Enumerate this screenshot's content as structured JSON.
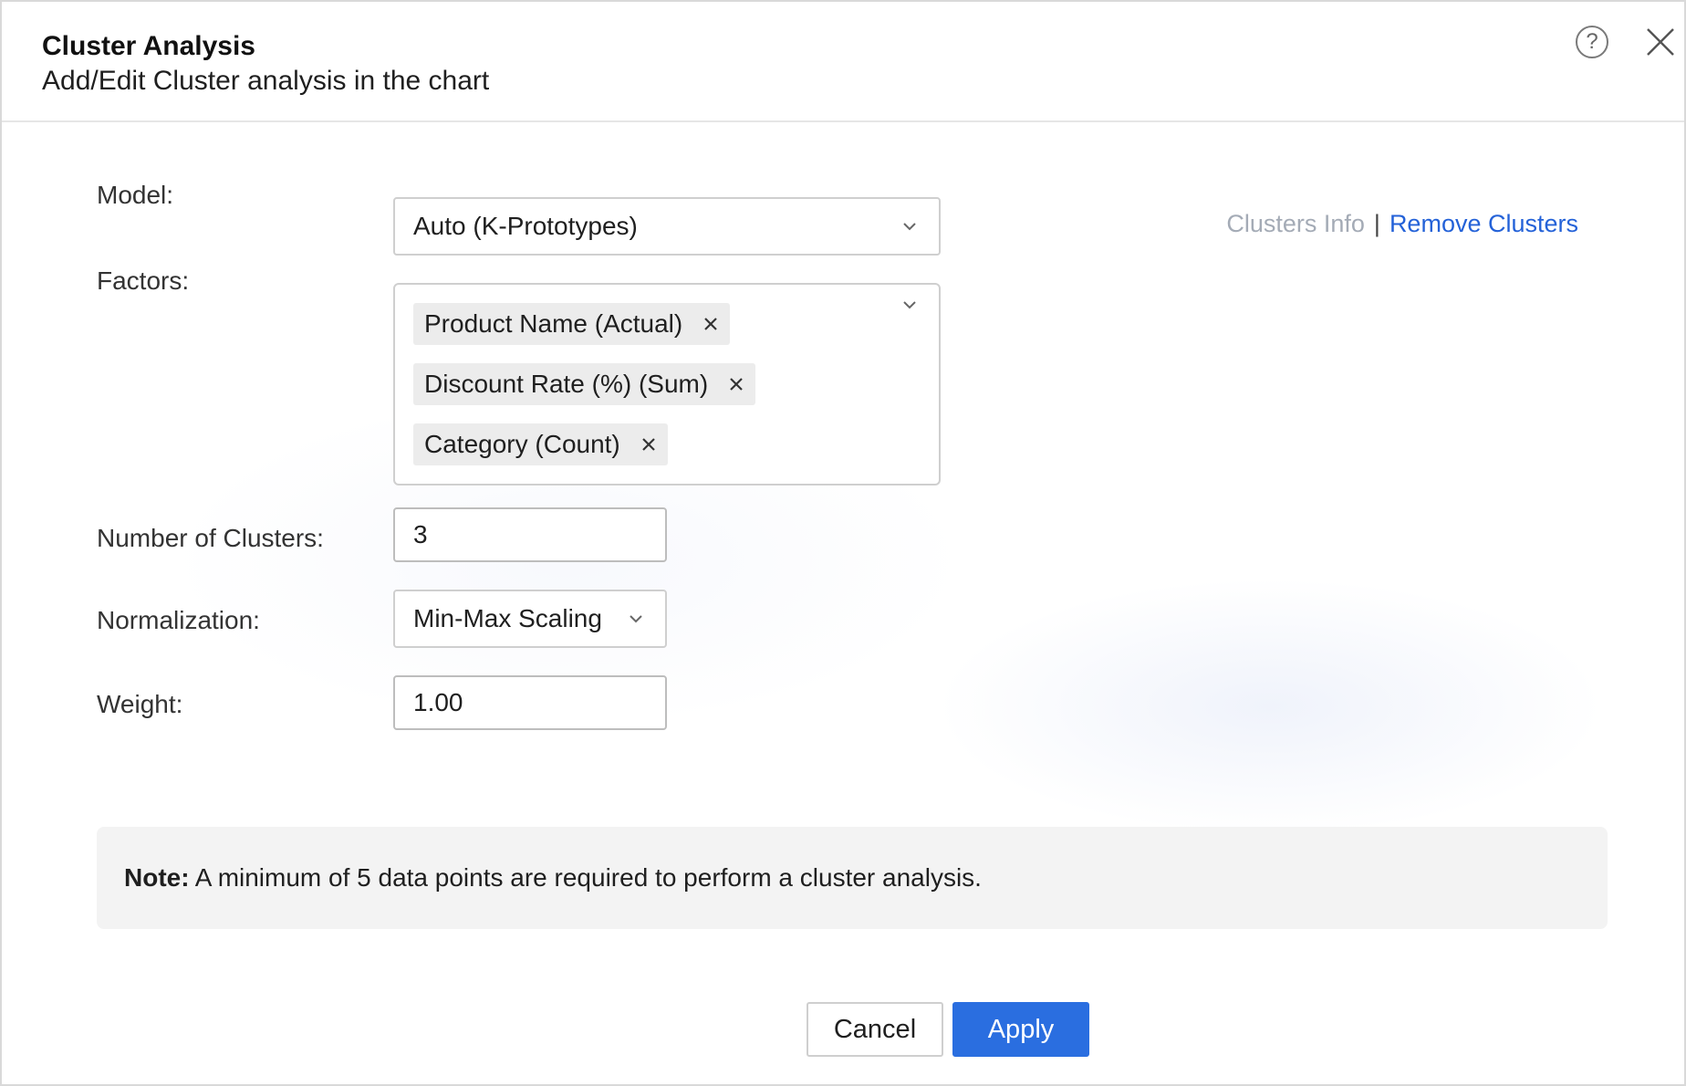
{
  "header": {
    "title": "Cluster Analysis",
    "subtitle": "Add/Edit Cluster analysis in the chart",
    "help_glyph": "?"
  },
  "model": {
    "label": "Model:",
    "value": "Auto (K-Prototypes)"
  },
  "links": {
    "clusters_info": "Clusters Info",
    "separator": "|",
    "remove_clusters": "Remove Clusters"
  },
  "factors": {
    "label": "Factors:",
    "chips": [
      "Product Name (Actual)",
      "Discount Rate (%) (Sum)",
      "Category (Count)"
    ]
  },
  "clusters": {
    "label": "Number of Clusters:",
    "value": "3"
  },
  "normalization": {
    "label": "Normalization:",
    "value": "Min-Max Scaling"
  },
  "weight": {
    "label": "Weight:",
    "value": "1.00"
  },
  "note": {
    "prefix": "Note:",
    "text": " A minimum of 5 data points are required to perform a cluster analysis."
  },
  "buttons": {
    "cancel": "Cancel",
    "apply": "Apply"
  },
  "colors": {
    "link_blue": "#2462d8",
    "link_disabled": "#a4abb6",
    "primary_button": "#2a6ee0",
    "note_bg": "#f3f3f3",
    "chip_bg": "#ececec"
  },
  "icons": {
    "help": "help-circle-icon",
    "close": "close-icon",
    "dropdown": "chevron-down-icon",
    "chip_remove": "x-icon"
  }
}
